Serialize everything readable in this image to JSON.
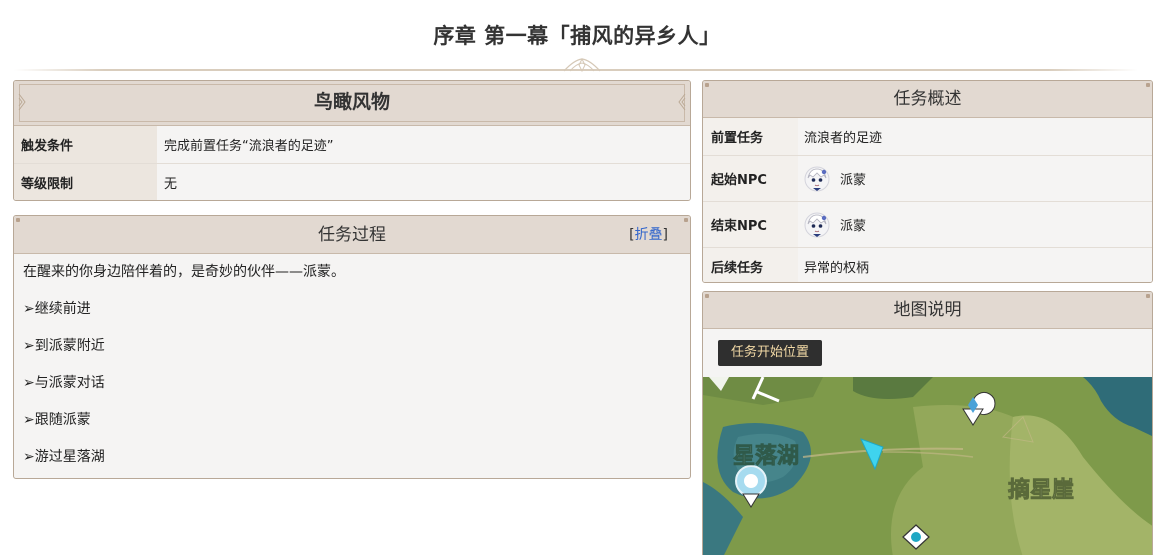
{
  "page": {
    "title": "序章 第一幕「捕风的异乡人」"
  },
  "overview_panel": {
    "title": "鸟瞰风物",
    "rows": [
      {
        "key": "触发条件",
        "value": "完成前置任务“流浪者的足迹”"
      },
      {
        "key": "等级限制",
        "value": "无"
      }
    ]
  },
  "process_panel": {
    "title": "任务过程",
    "collapse": {
      "open_bracket": "[",
      "label": "折叠",
      "close_bracket": "]"
    },
    "lines": [
      "在醒来的你身边陪伴着的，是奇妙的伙伴——派蒙。",
      "➢继续前进",
      "➢到派蒙附近",
      "➢与派蒙对话",
      "➢跟随派蒙",
      "➢游过星落湖"
    ]
  },
  "summary_panel": {
    "title": "任务概述",
    "prev_key": "前置任务",
    "prev_value": "流浪者的足迹",
    "start_key": "起始NPC",
    "start_value": "派蒙",
    "end_key": "结束NPC",
    "end_value": "派蒙",
    "next_key": "后续任务",
    "next_value": "异常的权柄",
    "npc_icon": "paimon-avatar"
  },
  "map_panel": {
    "title": "地图说明",
    "tag": "任务开始位置",
    "labels": {
      "lake": "星落湖",
      "cliff": "摘星崖"
    }
  },
  "colors": {
    "panel_head_bg": "#e2d9d1",
    "panel_border": "#b8a897",
    "link": "#3366cc",
    "map_tag_text": "#f2d9a6",
    "water": "#2f6c78",
    "land": "#8c9e4e"
  }
}
